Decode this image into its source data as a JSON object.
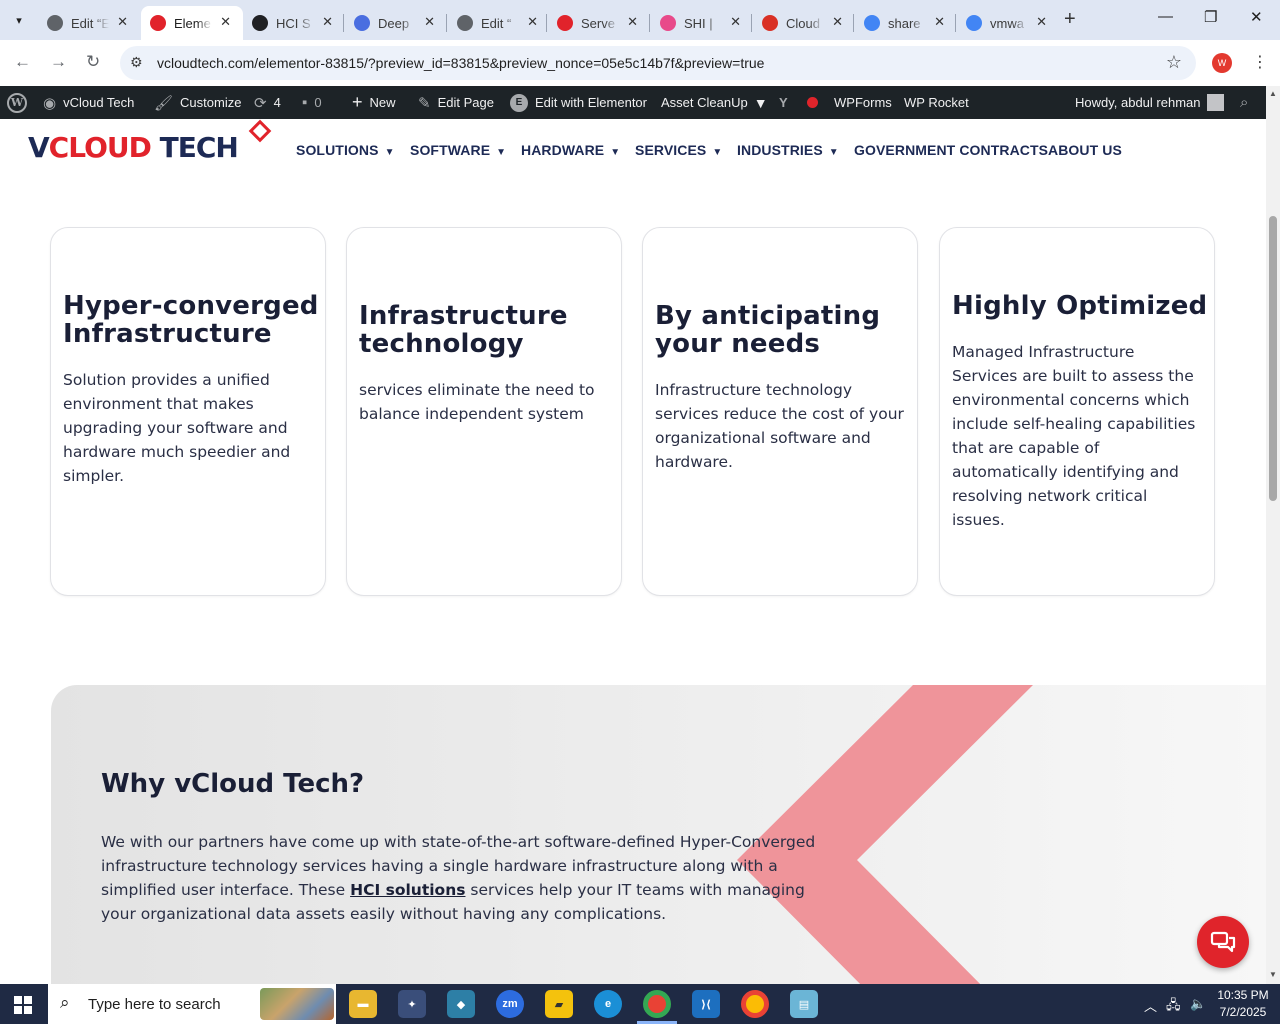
{
  "browser": {
    "tabs": [
      {
        "title": "Edit “E",
        "color": "#5f6368",
        "icon": "wordpress-icon"
      },
      {
        "title": "Eleme",
        "color": "#e1232b",
        "icon": "vcloud-icon"
      },
      {
        "title": "HCI S",
        "color": "#202124",
        "icon": "hci-icon"
      },
      {
        "title": "Deep",
        "color": "#4a6ee0",
        "icon": "deepseek-icon"
      },
      {
        "title": "Edit “",
        "color": "#5f6368",
        "icon": "wordpress-icon"
      },
      {
        "title": "Serve",
        "color": "#e1232b",
        "icon": "vcloud-icon"
      },
      {
        "title": "SHI | ",
        "color": "#e84a8a",
        "icon": "shi-icon"
      },
      {
        "title": "Cloud",
        "color": "#d93025",
        "icon": "cloud-icon"
      },
      {
        "title": "share",
        "color": "#4285f4",
        "icon": "google-icon"
      },
      {
        "title": "vmwa",
        "color": "#4285f4",
        "icon": "google-icon"
      }
    ],
    "url": "vcloudtech.com/elementor-83815/?preview_id=83815&preview_nonce=05e5c14b7f&preview=true",
    "profile_initial": "W"
  },
  "adminbar": {
    "site_name": "vCloud Tech",
    "customize": "Customize",
    "updates_count": "4",
    "comments_count": "0",
    "new_label": "New",
    "edit_page": "Edit Page",
    "edit_elementor": "Edit with Elementor",
    "asset_cleanup": "Asset CleanUp",
    "wpforms": "WPForms",
    "wp_rocket": "WP Rocket",
    "howdy": "Howdy, abdul rehman"
  },
  "header": {
    "logo_v": "V",
    "logo_cloud": "CLOUD",
    "logo_tech": " TECH",
    "nav": [
      {
        "label": "SOLUTIONS",
        "caret": true
      },
      {
        "label": "SOFTWARE",
        "caret": true
      },
      {
        "label": "HARDWARE",
        "caret": true
      },
      {
        "label": "SERVICES",
        "caret": true
      },
      {
        "label": "INDUSTRIES",
        "caret": true
      },
      {
        "label": "GOVERNMENT CONTRACTS",
        "caret": false
      },
      {
        "label": "ABOUT US",
        "caret": false
      }
    ]
  },
  "cards": [
    {
      "title": "Hyper-converged Infrastructure",
      "text": "Solution provides a unified environment that makes upgrading your software and hardware much speedier and simpler."
    },
    {
      "title": "Infrastructure technology",
      "text": "services eliminate the need to balance independent system"
    },
    {
      "title": "By anticipating your needs",
      "text": "Infrastructure technology services reduce the cost of your organizational software and hardware."
    },
    {
      "title": "Highly Optimized",
      "text": "Managed Infrastructure Services are built to assess the environmental concerns which include self-healing capabilities that are capable of automatically identifying and resolving network critical issues."
    }
  ],
  "why": {
    "heading": "Why vCloud Tech?",
    "text_before": "We with our partners have come up with state-of-the-art software-defined Hyper-Converged infrastructure technology services having a single hardware infrastructure along with a simplified user interface. These ",
    "link": "HCI solutions",
    "text_after": " services help your IT teams with managing your organizational data assets easily without having any complications."
  },
  "taskbar": {
    "search_placeholder": "Type here to search",
    "time": "10:35 PM",
    "date": "7/2/2025"
  },
  "colors": {
    "brand_red": "#e1232b",
    "brand_navy": "#1d2a55",
    "adminbar": "#1d2327"
  }
}
